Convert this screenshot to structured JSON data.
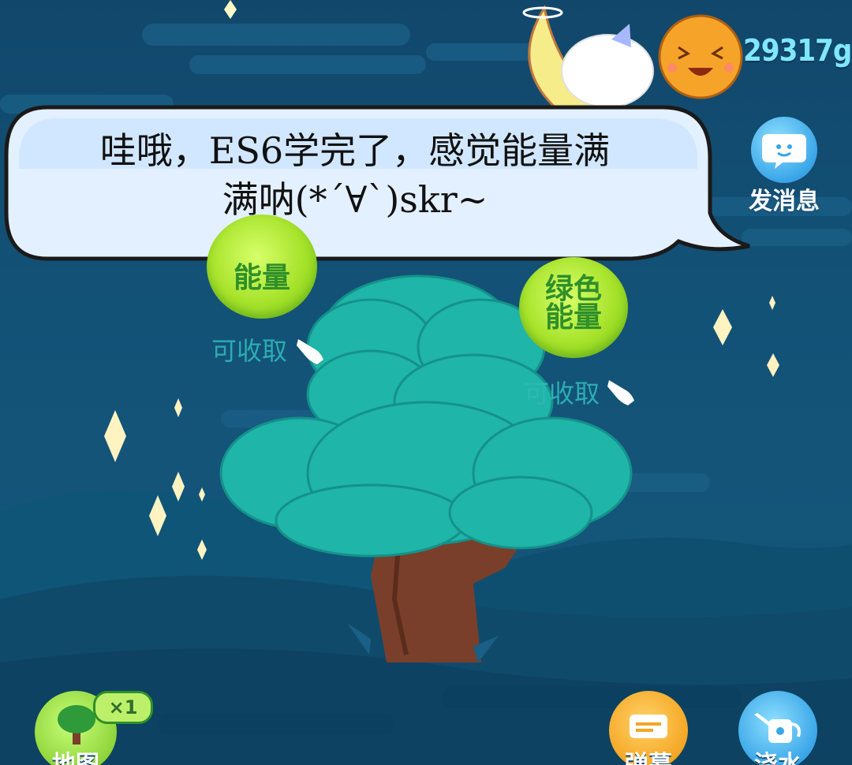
{
  "speech_bubble": {
    "line1": "哇哦，ES6学完了，感觉能量满",
    "line2": "满呐(*´∀`)skr~"
  },
  "header": {
    "energy_weight": "29317g"
  },
  "actions": {
    "send_message_label": "发消息"
  },
  "energy_balls": [
    {
      "label_line1": "",
      "label_line2": "能量",
      "status": "可收取"
    },
    {
      "label_line1": "绿色",
      "label_line2": "能量",
      "status": "可收取"
    }
  ],
  "bottom_bar": {
    "map_label": "地图",
    "map_count": "×1",
    "danmaku_label": "弹幕",
    "water_label": "浇水"
  },
  "colors": {
    "sky": "#135277",
    "tree_canopy": "#1fb5a8",
    "energy_green": "#a6e22a",
    "weight_text": "#7fe7ff"
  }
}
